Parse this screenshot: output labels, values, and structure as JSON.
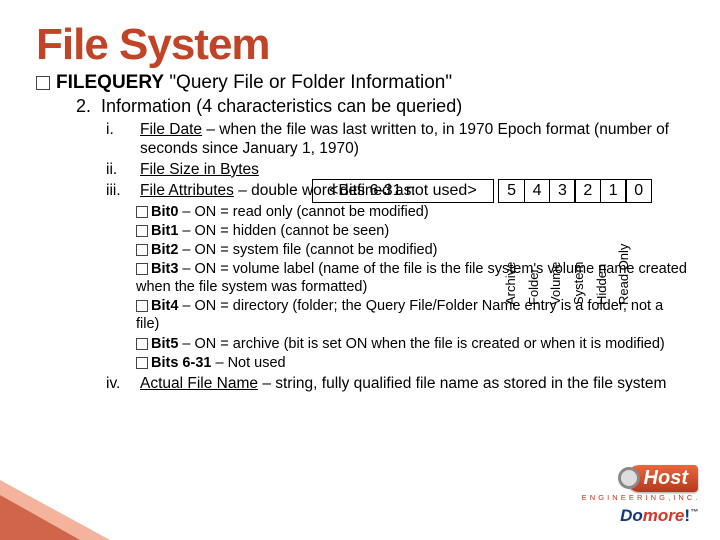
{
  "title": "File System",
  "filequery": {
    "name": "FILEQUERY",
    "desc": "\"Query File or Folder Information\""
  },
  "info_line": {
    "num": "2.",
    "text": "Information (4 characteristics can be queried)"
  },
  "items": {
    "i": {
      "rn": "i.",
      "label": "File Date",
      "rest": " – when the file was last written to, in 1970 Epoch format (number of seconds since January 1, 1970)"
    },
    "ii": {
      "rn": "ii.",
      "label": "File Size in Bytes",
      "rest": ""
    },
    "iii": {
      "rn": "iii.",
      "label": "File Attributes",
      "rest": " – double word defined as:"
    },
    "iv": {
      "rn": "iv.",
      "label": "Actual File Name",
      "rest": " – string, fully qualified file name as stored in the file system"
    }
  },
  "bits_diagram": {
    "not_used": "<Bits 6-31 not used>",
    "cells": [
      "5",
      "4",
      "3",
      "2",
      "1",
      "0"
    ],
    "labels": [
      "Archive",
      "Folder",
      "Volume",
      "System",
      "Hidden",
      "Read Only"
    ]
  },
  "bit_lines": [
    {
      "b": "Bit0",
      "t": " – ON = read only (cannot be modified)"
    },
    {
      "b": "Bit1",
      "t": " – ON = hidden (cannot be seen)"
    },
    {
      "b": "Bit2",
      "t": " – ON = system file (cannot be modified)"
    },
    {
      "b": "Bit3",
      "t": " – ON = volume label (name of the file is the file system's volume name created when the file system was formatted)"
    },
    {
      "b": "Bit4",
      "t": " – ON = directory (folder; the Query File/Folder Name entry is a folder, not a file)"
    },
    {
      "b": "Bit5",
      "t": " – ON = archive (bit is set ON when the file is created or when it is modified)"
    },
    {
      "b": "Bits 6-31",
      "t": " – Not used"
    }
  ],
  "logo": {
    "brand": "Host",
    "eng": "E N G I N E E R I N G , I N C .",
    "domore_do": "Do",
    "domore_more": "more",
    "domore_ex": "!",
    "tm": "™"
  }
}
